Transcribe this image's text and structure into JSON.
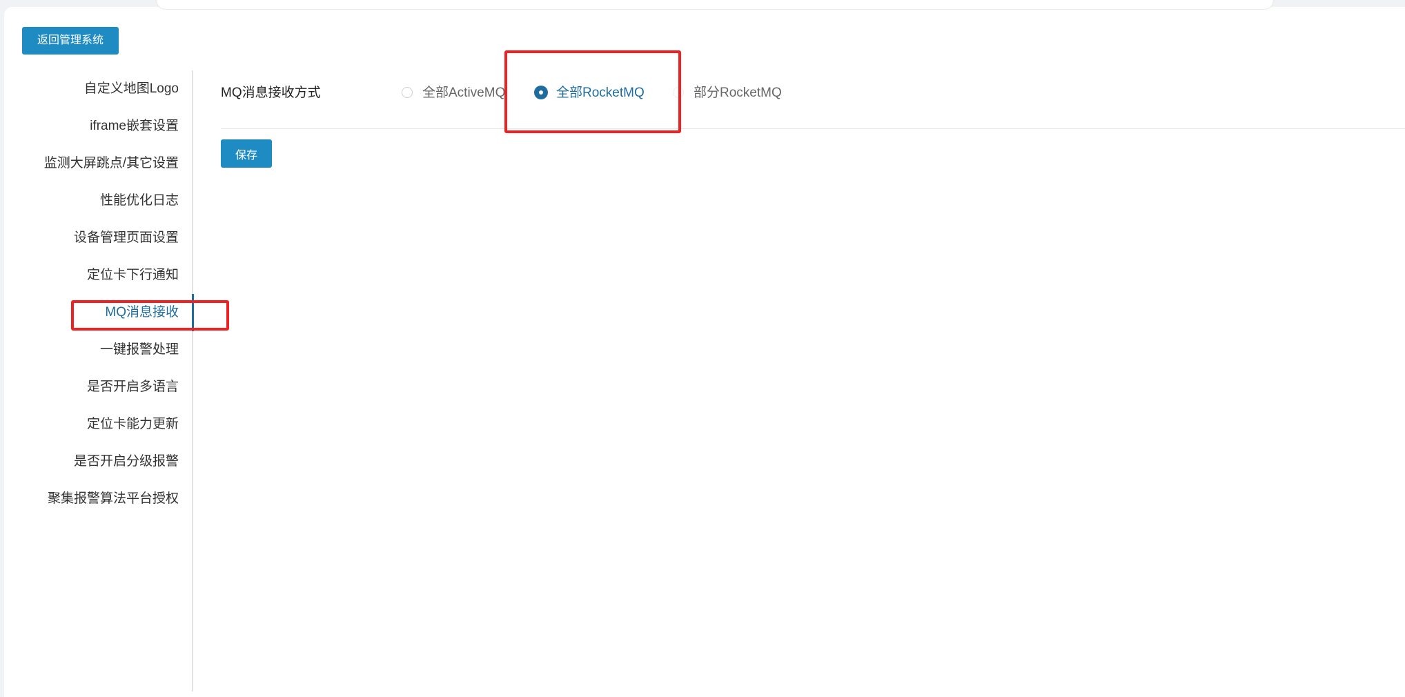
{
  "header": {
    "back_label": "返回管理系统"
  },
  "sidebar": {
    "items": [
      {
        "label": "自定义地图Logo"
      },
      {
        "label": "iframe嵌套设置"
      },
      {
        "label": "监测大屏跳点/其它设置"
      },
      {
        "label": "性能优化日志"
      },
      {
        "label": "设备管理页面设置"
      },
      {
        "label": "定位卡下行通知"
      },
      {
        "label": "MQ消息接收",
        "active": true
      },
      {
        "label": "一键报警处理"
      },
      {
        "label": "是否开启多语言"
      },
      {
        "label": "定位卡能力更新"
      },
      {
        "label": "是否开启分级报警"
      },
      {
        "label": "聚集报警算法平台授权"
      }
    ]
  },
  "form": {
    "label": "MQ消息接收方式",
    "options": [
      {
        "label": "全部ActiveMQ",
        "checked": false
      },
      {
        "label": "全部RocketMQ",
        "checked": true
      },
      {
        "label": "部分RocketMQ",
        "checked": false
      }
    ],
    "save_label": "保存"
  },
  "colors": {
    "primary_button": "#1e8bc3",
    "active_text": "#1f6d9e",
    "highlight": "#ee2222"
  }
}
